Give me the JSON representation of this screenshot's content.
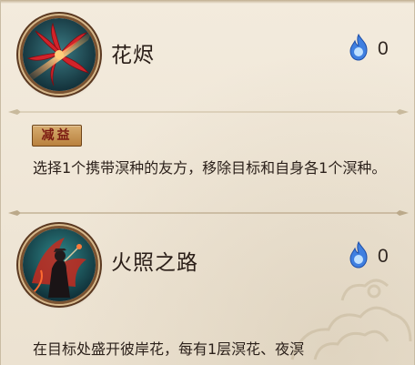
{
  "skills": [
    {
      "name": "花烬",
      "icon": "red-spider-lily-slash-icon",
      "cost_icon": "blue-soul-fire-icon",
      "cost": "0",
      "tag": "减益",
      "description": "选择1个携带溟种的友方，移除目标和自身各1个溟种。"
    },
    {
      "name": "火照之路",
      "icon": "shikigami-in-flames-icon",
      "cost_icon": "blue-soul-fire-icon",
      "cost": "0",
      "description": "在目标处盛开彼岸花，每有1层溟花、夜溟"
    }
  ],
  "colors": {
    "panel_bg": "#efe6d6",
    "tag_bg": "#c8924f",
    "tag_text": "#7b1a12",
    "cost_fire": "#3f7fe0"
  }
}
